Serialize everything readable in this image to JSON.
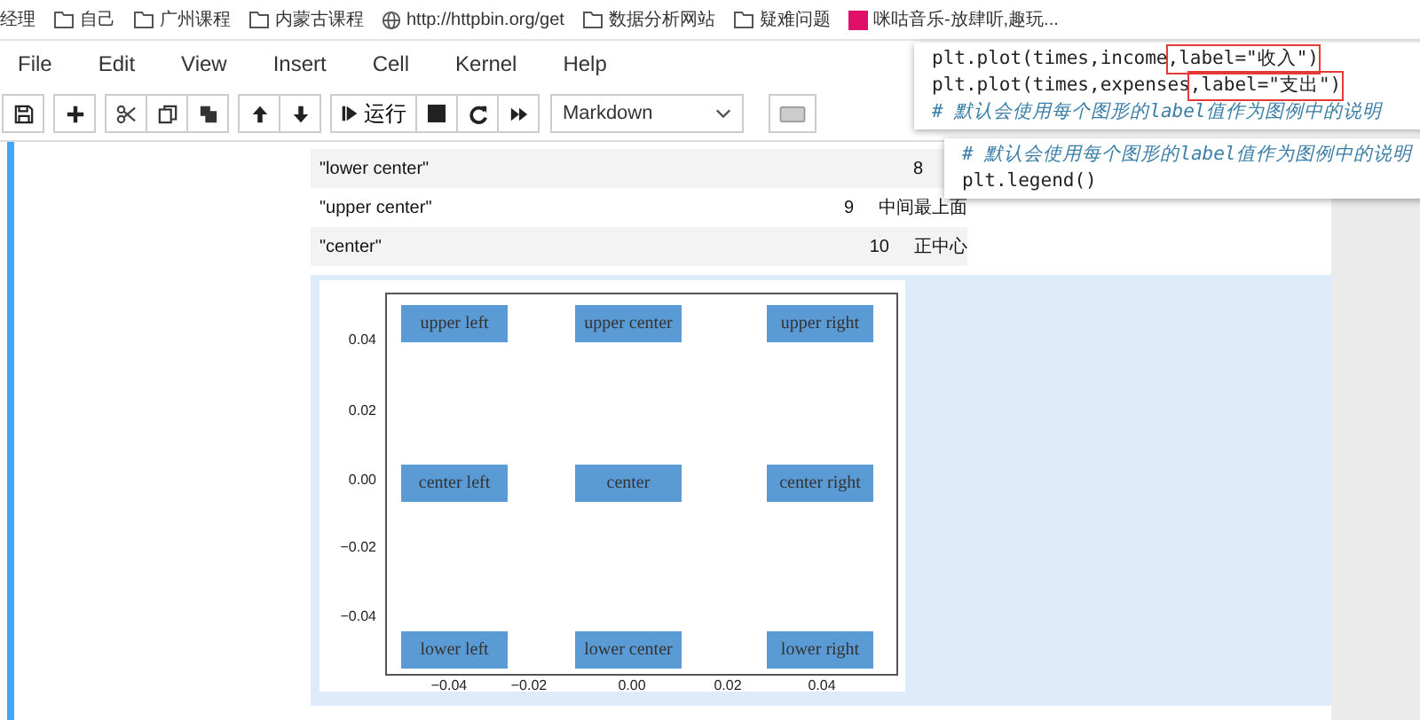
{
  "bookmarks": [
    {
      "label": "经理",
      "kind": "plain"
    },
    {
      "label": "自己",
      "kind": "folder"
    },
    {
      "label": "广州课程",
      "kind": "folder"
    },
    {
      "label": "内蒙古课程",
      "kind": "folder"
    },
    {
      "label": "http://httpbin.org/get",
      "kind": "globe"
    },
    {
      "label": "数据分析网站",
      "kind": "folder"
    },
    {
      "label": "疑难问题",
      "kind": "folder"
    },
    {
      "label": "咪咕音乐-放肆听,趣玩...",
      "kind": "app"
    }
  ],
  "menu": [
    "File",
    "Edit",
    "View",
    "Insert",
    "Cell",
    "Kernel",
    "Help"
  ],
  "toolbar": {
    "groups": [
      [
        {
          "kind": "save"
        }
      ],
      [
        {
          "kind": "plus"
        }
      ],
      [
        {
          "kind": "cut"
        },
        {
          "kind": "copy"
        },
        {
          "kind": "paste"
        }
      ],
      [
        {
          "kind": "up"
        },
        {
          "kind": "down"
        }
      ],
      [
        {
          "kind": "run",
          "label": "运行"
        },
        {
          "kind": "stop"
        },
        {
          "kind": "restart"
        },
        {
          "kind": "fastforward"
        }
      ]
    ],
    "cell_type": "Markdown"
  },
  "table": {
    "rows": [
      {
        "code": "\"lower center\"",
        "number": "8"
      },
      {
        "code": "\"upper center\"",
        "number": "9",
        "meaning": "中间最上面"
      },
      {
        "code": "\"center\"",
        "number": "10",
        "meaning": "正中心"
      }
    ]
  },
  "plot": {
    "yticks": [
      "0.04",
      "0.02",
      "0.00",
      "−0.02",
      "−0.04"
    ],
    "xticks": [
      "−0.04",
      "−0.02",
      "0.00",
      "0.02",
      "0.04"
    ],
    "legends": [
      "upper left",
      "upper center",
      "upper right",
      "center left",
      "center",
      "center right",
      "lower left",
      "lower center",
      "lower right"
    ]
  },
  "popups": [
    {
      "lines": [
        [
          {
            "text": "plt.plot(times,income",
            "highlighted": false
          },
          {
            "text": ",label=\"收入\")",
            "highlighted": true
          }
        ],
        [
          {
            "text": "plt.plot(times,expenses",
            "highlighted": false
          },
          {
            "text": ",label=\"支出\")",
            "highlighted": true
          }
        ],
        [
          {
            "text": "# 默认会使用每个图形的label值作为图例中的说明",
            "highlighted": false,
            "kind": "comment"
          }
        ]
      ]
    },
    {
      "lines": [
        [
          {
            "text": "# 默认会使用每个图形的label值作为图例中的说明",
            "highlighted": false,
            "kind": "comment"
          }
        ],
        [
          {
            "text": "plt.legend()",
            "highlighted": false
          }
        ]
      ]
    }
  ]
}
